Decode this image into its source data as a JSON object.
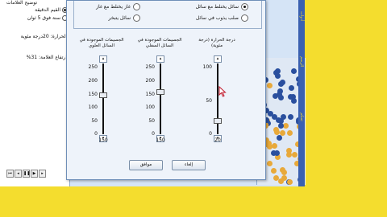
{
  "left_panel": {
    "title": "توضيح العلامات",
    "radios": [
      {
        "label": "القيم الدقيقة",
        "selected": true
      },
      {
        "label": "سنة فوق 5 ثوان",
        "selected": false
      }
    ],
    "temp_text": "الحرارة: 20درجة مئوية",
    "rise_text": "ارتفاع العلامة: 31%"
  },
  "dialog": {
    "options": [
      {
        "label": "سائل يختلط مع سائل",
        "selected": true
      },
      {
        "label": "غاز يختلط مع غاز",
        "selected": false
      },
      {
        "label": "صلب يذوب في سائل",
        "selected": false
      },
      {
        "label": "سائل يتبخر",
        "selected": false
      }
    ],
    "columns": [
      {
        "title": "درجة الحرارة (درجة مئوية)",
        "ticks": [
          "100",
          "50",
          "0"
        ],
        "value": "20"
      },
      {
        "title": "الجسيمات الموجودة في السائل السفلي",
        "ticks": [
          "250",
          "200",
          "150",
          "100",
          "50",
          "0"
        ],
        "value": "150"
      },
      {
        "title": "الجسيمات الموجودة في السائل العلوي",
        "ticks": [
          "250",
          "200",
          "150",
          "100",
          "50",
          "0"
        ],
        "value": "150"
      }
    ],
    "cancel_label": "إلغاء",
    "ok_label": "موافق"
  },
  "right_strip": {
    "labels": [
      "أدوات",
      "الرسم",
      "تحكم"
    ]
  },
  "colors": {
    "background": "#f4dd2e",
    "particle_blue": "#2a4f9e",
    "particle_gold": "#e8a93a"
  },
  "icons": [
    "cursor-arrow-icon",
    "play-icon",
    "pause-icon",
    "step-icon",
    "rewind-icon"
  ]
}
